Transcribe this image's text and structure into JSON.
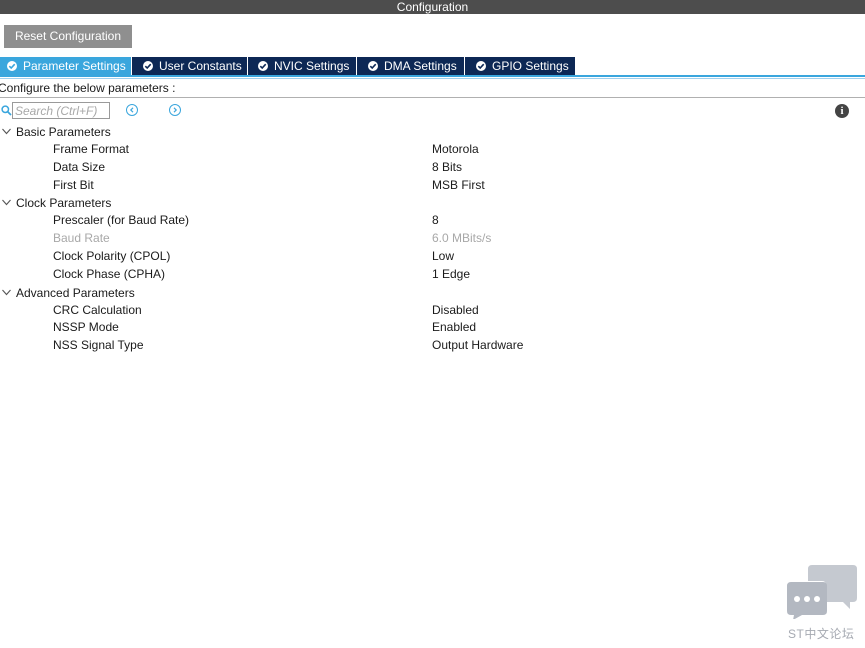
{
  "window": {
    "title": "Configuration"
  },
  "toolbar": {
    "reset_label": "Reset Configuration"
  },
  "tabs": [
    {
      "label": "Parameter Settings",
      "active": true
    },
    {
      "label": "User Constants",
      "active": false
    },
    {
      "label": "NVIC Settings",
      "active": false
    },
    {
      "label": "DMA Settings",
      "active": false
    },
    {
      "label": "GPIO Settings",
      "active": false
    }
  ],
  "instruction": "Configure the below parameters :",
  "search": {
    "placeholder": "Search (Ctrl+F)",
    "value": ""
  },
  "icons": {
    "search": "search-icon",
    "prev": "chevron-left-circle-icon",
    "next": "chevron-right-circle-icon",
    "info": "info-icon",
    "tab_status": "check-circle-icon",
    "group_toggle": "chevron-down-icon"
  },
  "groups": [
    {
      "label": "Basic Parameters",
      "expanded": true,
      "params": [
        {
          "name": "Frame Format",
          "value": "Motorola",
          "enabled": true
        },
        {
          "name": "Data Size",
          "value": "8 Bits",
          "enabled": true
        },
        {
          "name": "First Bit",
          "value": "MSB First",
          "enabled": true
        }
      ]
    },
    {
      "label": "Clock Parameters",
      "expanded": true,
      "params": [
        {
          "name": "Prescaler (for Baud Rate)",
          "value": "8",
          "enabled": true
        },
        {
          "name": "Baud Rate",
          "value": "6.0 MBits/s",
          "enabled": false
        },
        {
          "name": "Clock Polarity (CPOL)",
          "value": "Low",
          "enabled": true
        },
        {
          "name": "Clock Phase (CPHA)",
          "value": "1 Edge",
          "enabled": true
        }
      ]
    },
    {
      "label": "Advanced Parameters",
      "expanded": true,
      "params": [
        {
          "name": "CRC Calculation",
          "value": "Disabled",
          "enabled": true
        },
        {
          "name": "NSSP Mode",
          "value": "Enabled",
          "enabled": true
        },
        {
          "name": "NSS Signal Type",
          "value": "Output Hardware",
          "enabled": true
        }
      ]
    }
  ],
  "watermark": {
    "text": "ST中文论坛"
  },
  "colors": {
    "title_bar": "#4d4d4d",
    "tab_active": "#3aa6dd",
    "tab_inactive": "#0d2855",
    "reset_button": "#8f8f8f",
    "disabled_text": "#a8a8a8",
    "watermark": "#a6aab2"
  }
}
